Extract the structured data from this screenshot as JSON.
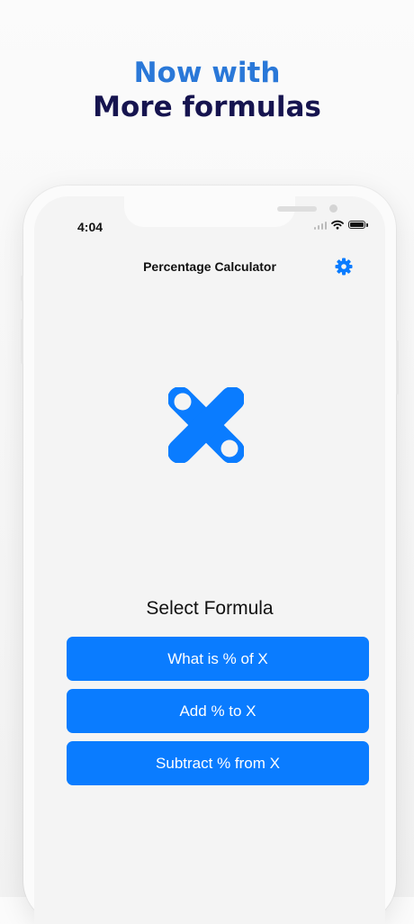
{
  "headline": {
    "line1": "Now with",
    "line2": "More formulas"
  },
  "status_bar": {
    "time": "4:04"
  },
  "nav": {
    "title": "Percentage Calculator",
    "settings_icon": "gear-icon"
  },
  "logo": {
    "icon": "app-logo-icon",
    "color": "#0a7cff"
  },
  "main": {
    "select_label": "Select Formula",
    "formulas": [
      {
        "label": "What is % of X"
      },
      {
        "label": "Add % to X"
      },
      {
        "label": "Subtract % from X"
      }
    ]
  },
  "colors": {
    "accent": "#0a7cff",
    "headline_blue": "#2a78d8",
    "headline_navy": "#16144f"
  }
}
